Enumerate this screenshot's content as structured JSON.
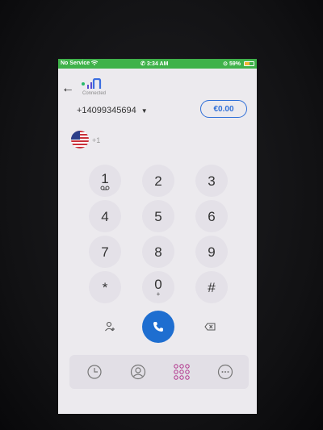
{
  "status_bar": {
    "carrier": "No Service",
    "time": "3:34 AM",
    "battery": "59%",
    "battery_level": 0.59
  },
  "header": {
    "app_status": "Connected"
  },
  "caller": {
    "number": "+14099345694",
    "balance": "€0.00",
    "country_code": "+1"
  },
  "keypad": {
    "keys": [
      {
        "digit": "1",
        "sub": "voicemail-icon"
      },
      {
        "digit": "2",
        "sub": ""
      },
      {
        "digit": "3",
        "sub": ""
      },
      {
        "digit": "4",
        "sub": ""
      },
      {
        "digit": "5",
        "sub": ""
      },
      {
        "digit": "6",
        "sub": ""
      },
      {
        "digit": "7",
        "sub": ""
      },
      {
        "digit": "8",
        "sub": ""
      },
      {
        "digit": "9",
        "sub": ""
      },
      {
        "digit": "*",
        "sub": ""
      },
      {
        "digit": "0",
        "sub": "+"
      },
      {
        "digit": "#",
        "sub": ""
      }
    ]
  },
  "actions": {
    "add_contact_icon": "add-contact-icon",
    "call_icon": "phone-icon",
    "backspace_icon": "backspace-icon"
  },
  "tabs": [
    {
      "icon": "clock-icon",
      "name": "recents"
    },
    {
      "icon": "person-icon",
      "name": "contacts"
    },
    {
      "icon": "dialpad-icon",
      "name": "keypad",
      "active": true
    },
    {
      "icon": "chat-icon",
      "name": "messages"
    }
  ],
  "colors": {
    "status_bar": "#3fb24a",
    "accent": "#2f6fd8",
    "call": "#1e6ed0",
    "dialpad_active": "#b0308a"
  }
}
